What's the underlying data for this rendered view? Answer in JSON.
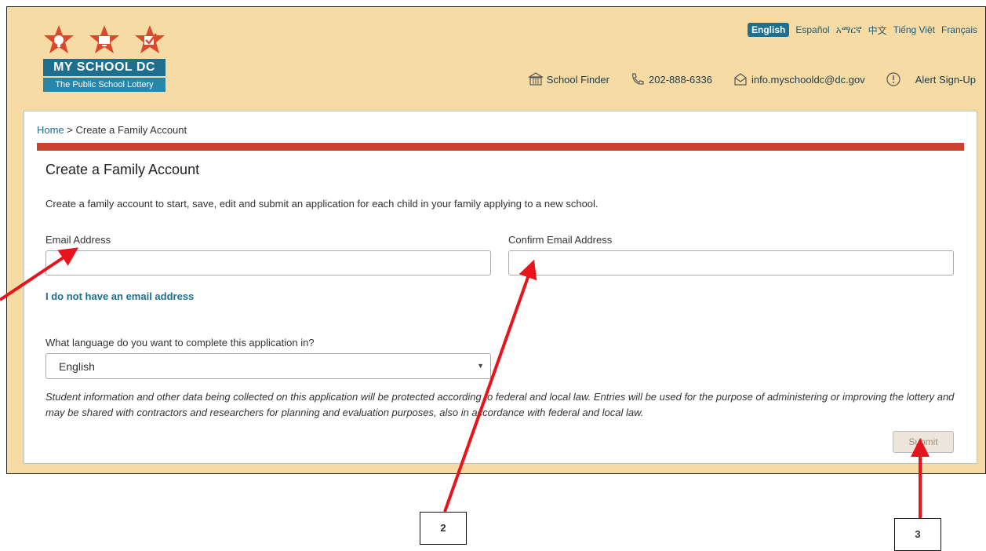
{
  "brand": {
    "title": "MY SCHOOL DC",
    "subtitle": "The Public School Lottery"
  },
  "languages": [
    "English",
    "Español",
    "አማርኛ",
    "中文",
    "Tiếng Việt",
    "Français"
  ],
  "contact": {
    "school_finder": "School Finder",
    "phone": "202-888-6336",
    "email": "info.myschooldc@dc.gov",
    "alert": "Alert Sign-Up"
  },
  "breadcrumb": {
    "home": "Home",
    "separator": " > ",
    "current": "Create a Family Account"
  },
  "page": {
    "title": "Create a Family Account",
    "intro": "Create a family account to start, save, edit and submit an application for each child in your family applying to a new school."
  },
  "form": {
    "email_label": "Email Address",
    "email_value": "",
    "confirm_label": "Confirm Email Address",
    "confirm_value": "",
    "no_email_link": "I do not have an email address",
    "language_question": "What language do you want to complete this application in?",
    "language_selected": "English",
    "disclaimer": "Student information and other data being collected on this application will be protected according to federal and local law. Entries will be used for the purpose of administering or improving the lottery and may be shared with contractors and researchers for planning and evaluation purposes, also in accordance with federal and local law.",
    "submit_label": "Submit"
  },
  "callouts": [
    "2",
    "3"
  ],
  "colors": {
    "header_bg": "#f7dba4",
    "accent_red": "#c9432e",
    "brand_blue": "#1e6e8e",
    "arrow": "#e8141b"
  }
}
